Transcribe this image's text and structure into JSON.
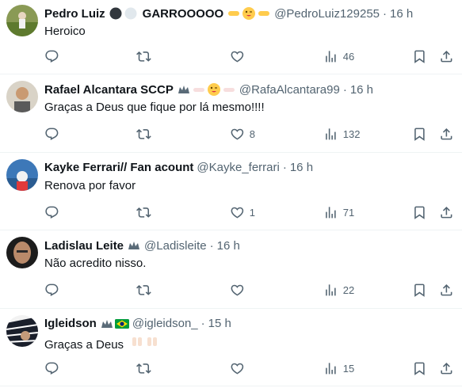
{
  "tweets": [
    {
      "name": "Pedro Luiz",
      "name_suffix": "GARROOOOO",
      "handle": "@PedroLuiz129255",
      "time": "16 h",
      "text": "Heroico",
      "replies": "",
      "retweets": "",
      "likes": "",
      "views": "46",
      "avatar_color": "#6b7d3a"
    },
    {
      "name": "Rafael Alcantara SCCP",
      "handle": "@RafaAlcantara99",
      "time": "16 h",
      "text": "Graças a Deus que fique por lá mesmo!!!!",
      "replies": "",
      "retweets": "",
      "likes": "8",
      "views": "132",
      "avatar_color": "#c9b8a6"
    },
    {
      "name": "Kayke Ferrari// Fan acount",
      "handle": "@Kayke_ferrari",
      "time": "16 h",
      "text": "Renova por favor",
      "replies": "",
      "retweets": "",
      "likes": "1",
      "views": "71",
      "avatar_color": "#4a7fb5"
    },
    {
      "name": "Ladislau Leite",
      "handle": "@Ladisleite",
      "time": "16 h",
      "text": "Não acredito nisso.",
      "replies": "",
      "retweets": "",
      "likes": "",
      "views": "22",
      "avatar_color": "#2b2b2b"
    },
    {
      "name": "Igleidson",
      "handle": "@igleidson_",
      "time": "15 h",
      "text": "Graças a Deus",
      "replies": "",
      "retweets": "",
      "likes": "",
      "views": "15",
      "avatar_color": "#1a1f2b"
    }
  ],
  "separator": "·",
  "icons": [
    "reply-icon",
    "retweet-icon",
    "like-icon",
    "views-icon",
    "bookmark-icon",
    "share-icon",
    "more-icon"
  ]
}
